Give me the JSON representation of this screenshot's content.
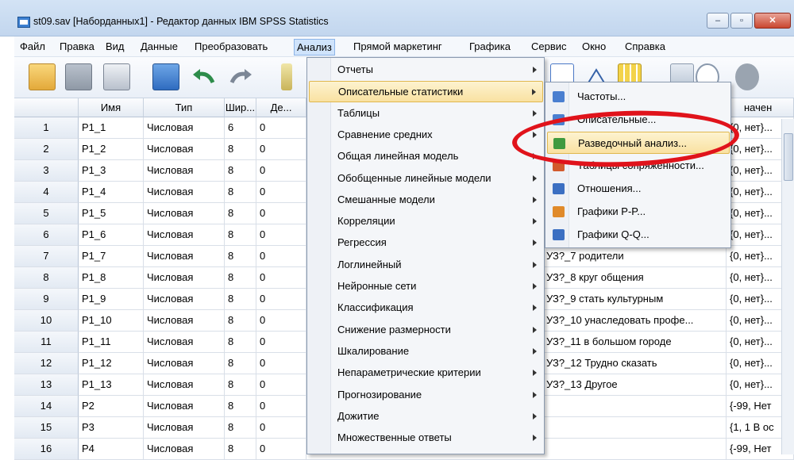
{
  "window": {
    "title": "st09.sav [Наборданных1] - Редактор данных IBM SPSS Statistics",
    "controls": [
      "–",
      "▫",
      "✕"
    ]
  },
  "menubar": [
    "Файл",
    "Правка",
    "Вид",
    "Данные",
    "Преобразовать",
    "Анализ",
    "Прямой маркетинг",
    "Графика",
    "Сервис",
    "Окно",
    "Справка"
  ],
  "grid": {
    "columns": [
      "Имя",
      "Тип",
      "Шир...",
      "Де...",
      "начен"
    ],
    "rows": [
      {
        "n": "1",
        "name": "P1_1",
        "type": "Числовая",
        "width": "6",
        "dec": "0",
        "label": "",
        "values": "{0, нет}..."
      },
      {
        "n": "2",
        "name": "P1_2",
        "type": "Числовая",
        "width": "8",
        "dec": "0",
        "label": "",
        "values": "{0, нет}..."
      },
      {
        "n": "3",
        "name": "P1_3",
        "type": "Числовая",
        "width": "8",
        "dec": "0",
        "label": "",
        "values": "{0, нет}..."
      },
      {
        "n": "4",
        "name": "P1_4",
        "type": "Числовая",
        "width": "8",
        "dec": "0",
        "label": "",
        "values": "{0, нет}..."
      },
      {
        "n": "5",
        "name": "P1_5",
        "type": "Числовая",
        "width": "8",
        "dec": "0",
        "label": "",
        "values": "{0, нет}..."
      },
      {
        "n": "6",
        "name": "P1_6",
        "type": "Числовая",
        "width": "8",
        "dec": "0",
        "label": "",
        "values": "{0, нет}..."
      },
      {
        "n": "7",
        "name": "P1_7",
        "type": "Числовая",
        "width": "8",
        "dec": "0",
        "label": "УЗ?_7 родители",
        "values": "{0, нет}..."
      },
      {
        "n": "8",
        "name": "P1_8",
        "type": "Числовая",
        "width": "8",
        "dec": "0",
        "label": "УЗ?_8 круг общения",
        "values": "{0, нет}..."
      },
      {
        "n": "9",
        "name": "P1_9",
        "type": "Числовая",
        "width": "8",
        "dec": "0",
        "label": "УЗ?_9 стать культурным",
        "values": "{0, нет}..."
      },
      {
        "n": "10",
        "name": "P1_10",
        "type": "Числовая",
        "width": "8",
        "dec": "0",
        "label": "УЗ?_10 унаследовать профе...",
        "values": "{0, нет}..."
      },
      {
        "n": "11",
        "name": "P1_11",
        "type": "Числовая",
        "width": "8",
        "dec": "0",
        "label": "УЗ?_11 в большом городе",
        "values": "{0, нет}..."
      },
      {
        "n": "12",
        "name": "P1_12",
        "type": "Числовая",
        "width": "8",
        "dec": "0",
        "label": "УЗ?_12 Трудно сказать",
        "values": "{0, нет}..."
      },
      {
        "n": "13",
        "name": "P1_13",
        "type": "Числовая",
        "width": "8",
        "dec": "0",
        "label": "УЗ?_13 Другое",
        "values": "{0, нет}..."
      },
      {
        "n": "14",
        "name": "P2",
        "type": "Числовая",
        "width": "8",
        "dec": "0",
        "label": "",
        "values": "{-99, Нет"
      },
      {
        "n": "15",
        "name": "P3",
        "type": "Числовая",
        "width": "8",
        "dec": "0",
        "label": "",
        "values": "{1, 1 В ос"
      },
      {
        "n": "16",
        "name": "P4",
        "type": "Числовая",
        "width": "8",
        "dec": "0",
        "label": "",
        "values": "{-99, Нет"
      }
    ]
  },
  "analyze_menu": [
    {
      "label": "Отчеты",
      "arrow": true
    },
    {
      "label": "Описательные статистики",
      "arrow": true,
      "selected": true
    },
    {
      "label": "Таблицы",
      "arrow": true
    },
    {
      "label": "Сравнение средних",
      "arrow": true
    },
    {
      "label": "Общая линейная модель",
      "arrow": true
    },
    {
      "label": "Обобщенные линейные модели",
      "arrow": true
    },
    {
      "label": "Смешанные модели",
      "arrow": true
    },
    {
      "label": "Корреляции",
      "arrow": true
    },
    {
      "label": "Регрессия",
      "arrow": true
    },
    {
      "label": "Логлинейный",
      "arrow": true
    },
    {
      "label": "Нейронные сети",
      "arrow": true
    },
    {
      "label": "Классификация",
      "arrow": true
    },
    {
      "label": "Снижение размерности",
      "arrow": true
    },
    {
      "label": "Шкалирование",
      "arrow": true
    },
    {
      "label": "Непараметрические критерии",
      "arrow": true
    },
    {
      "label": "Прогнозирование",
      "arrow": true
    },
    {
      "label": "Дожитие",
      "arrow": true
    },
    {
      "label": "Множественные ответы",
      "arrow": true
    }
  ],
  "descriptive_submenu": [
    {
      "label": "Частоты...",
      "icon": "frequencies-icon",
      "color": "#4a7fd0"
    },
    {
      "label": "Описательные...",
      "icon": "descriptives-icon",
      "color": "#4a7fd0"
    },
    {
      "label": "Разведочный анализ...",
      "icon": "explore-icon",
      "color": "#3f9a3f",
      "selected": true
    },
    {
      "label": "Таблицы сопряженности...",
      "icon": "crosstabs-icon",
      "color": "#d25a2c"
    },
    {
      "label": "Отношения...",
      "icon": "ratio-icon",
      "color": "#3b6fc2"
    },
    {
      "label": "Графики P-P...",
      "icon": "pp-plot-icon",
      "color": "#e08a2a"
    },
    {
      "label": "Графики Q-Q...",
      "icon": "qq-plot-icon",
      "color": "#3b6fc2"
    }
  ],
  "highlight_color": "#e0131b"
}
